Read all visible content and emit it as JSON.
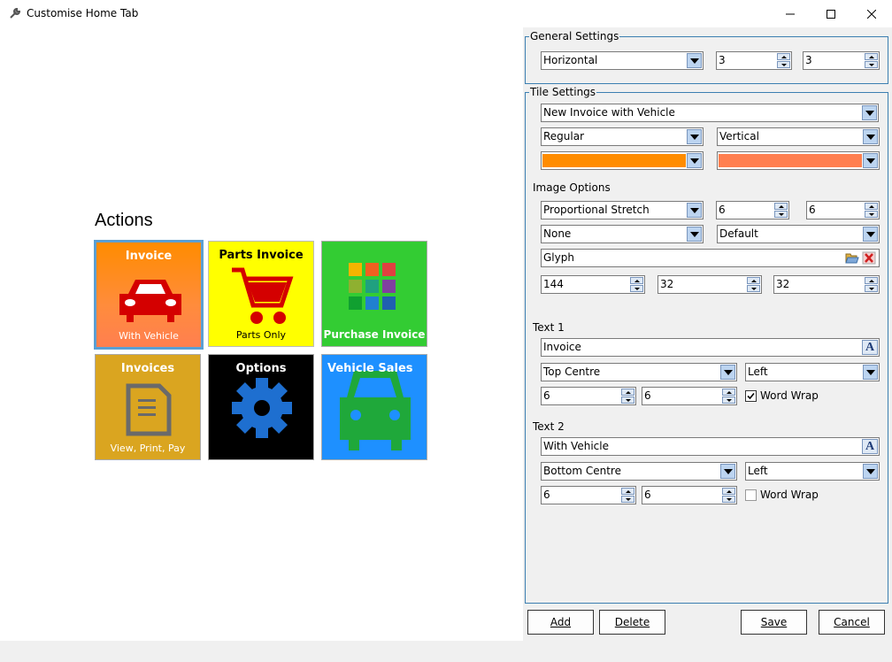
{
  "window": {
    "title": "Customise Home Tab"
  },
  "preview": {
    "group_title": "Actions",
    "tiles": [
      {
        "text1": "Invoice",
        "text2": "With Vehicle",
        "bg": "#ff8c00",
        "icon": "car-front-icon"
      },
      {
        "text1": "Parts Invoice",
        "text2": "Parts Only",
        "bg": "#ffff00",
        "icon": "shopping-cart-icon"
      },
      {
        "text1": "Purchase Invoice",
        "text2": "",
        "bg": "#33cc33",
        "icon": "color-grid-icon"
      },
      {
        "text1": "Invoices",
        "text2": "View, Print, Pay",
        "bg": "#daa520",
        "icon": "document-icon"
      },
      {
        "text1": "Options",
        "text2": "",
        "bg": "#000000",
        "icon": "gear-icon"
      },
      {
        "text1": "Vehicle Sales",
        "text2": "",
        "bg": "#1e90ff",
        "icon": "car-front-icon"
      }
    ]
  },
  "general_settings": {
    "title": "General Settings",
    "orientation": "Horizontal",
    "columns": "3",
    "rows": "3"
  },
  "tile_settings": {
    "title": "Tile Settings",
    "tile_select": "New Invoice with Vehicle",
    "size": "Regular",
    "direction": "Vertical",
    "color1": "#ff8c00",
    "color2": "#ff7f50",
    "image_options": {
      "label": "Image Options",
      "stretch": "Proportional Stretch",
      "spin1": "6",
      "spin2": "6",
      "effect": "None",
      "align": "Default",
      "glyph": "Glyph",
      "size1": "144",
      "size2": "32",
      "size3": "32"
    },
    "text1": {
      "label": "Text 1",
      "value": "Invoice",
      "position": "Top Centre",
      "align": "Left",
      "spin1": "6",
      "spin2": "6",
      "word_wrap_label": "Word Wrap",
      "word_wrap": true
    },
    "text2": {
      "label": "Text 2",
      "value": "With Vehicle",
      "position": "Bottom Centre",
      "align": "Left",
      "spin1": "6",
      "spin2": "6",
      "word_wrap_label": "Word Wrap",
      "word_wrap": false
    }
  },
  "buttons": {
    "add": "Add",
    "delete": "Delete",
    "save": "Save",
    "cancel": "Cancel"
  },
  "colors": {
    "accent_border": "#3c7fb1",
    "selected_tile_border": "#5a9fd4"
  }
}
